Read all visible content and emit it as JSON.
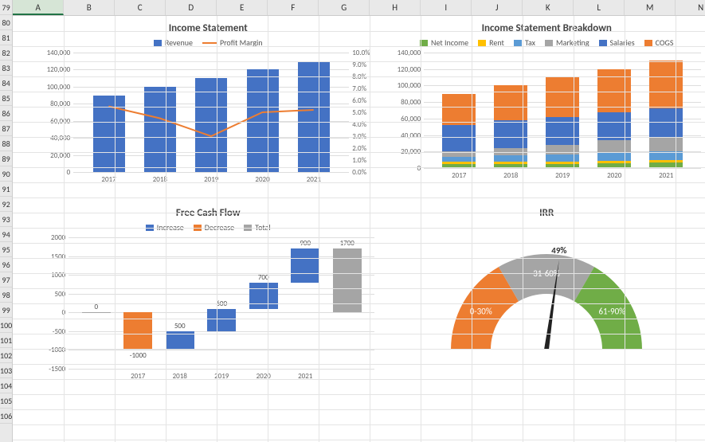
{
  "rows_start": 79,
  "rows_end": 106,
  "columns": [
    "A",
    "B",
    "C",
    "D",
    "E",
    "F",
    "G",
    "H",
    "I",
    "J",
    "K",
    "L",
    "M",
    "N"
  ],
  "selected_column": "A",
  "chart_data": [
    {
      "id": "income_statement",
      "type": "bar+line",
      "title": "Income Statement",
      "categories": [
        "2017",
        "2018",
        "2019",
        "2020",
        "2021"
      ],
      "series": [
        {
          "name": "Revenue",
          "type": "bar",
          "color": "#4472C4",
          "values": [
            90000,
            100000,
            110000,
            120000,
            130000
          ],
          "axis": "left"
        },
        {
          "name": "Profit Margin",
          "type": "line",
          "color": "#ED7D31",
          "values": [
            0.055,
            0.045,
            0.03,
            0.05,
            0.052
          ],
          "axis": "right"
        }
      ],
      "y_left": {
        "min": 0,
        "max": 140000,
        "step": 20000,
        "labels": [
          "0",
          "20,000",
          "40,000",
          "60,000",
          "80,000",
          "100,000",
          "120,000",
          "140,000"
        ]
      },
      "y_right": {
        "min": 0,
        "max": 0.1,
        "step": 0.01,
        "labels": [
          "0.0%",
          "1.0%",
          "2.0%",
          "3.0%",
          "4.0%",
          "5.0%",
          "6.0%",
          "7.0%",
          "8.0%",
          "9.0%",
          "10.0%"
        ]
      }
    },
    {
      "id": "income_breakdown",
      "type": "stacked-bar",
      "title": "Income Statement Breakdown",
      "categories": [
        "2017",
        "2018",
        "2019",
        "2020",
        "2021"
      ],
      "series": [
        {
          "name": "Net Income",
          "color": "#70AD47",
          "values": [
            5000,
            5000,
            5000,
            6000,
            7000
          ]
        },
        {
          "name": "Rent",
          "color": "#FFC000",
          "values": [
            3000,
            3000,
            3000,
            3000,
            3000
          ]
        },
        {
          "name": "Tax",
          "color": "#5B9BD5",
          "values": [
            6000,
            7000,
            8000,
            9000,
            10000
          ]
        },
        {
          "name": "Marketing",
          "color": "#A5A5A5",
          "values": [
            6000,
            9000,
            12000,
            16000,
            18000
          ]
        },
        {
          "name": "Salaries",
          "color": "#4472C4",
          "values": [
            32000,
            34000,
            34000,
            34000,
            34000
          ]
        },
        {
          "name": "COGS",
          "color": "#ED7D31",
          "values": [
            38000,
            42000,
            48000,
            52000,
            58000
          ]
        }
      ],
      "y": {
        "min": 0,
        "max": 140000,
        "step": 20000,
        "labels": [
          "0",
          "20,000",
          "40,000",
          "60,000",
          "80,000",
          "100,000",
          "120,000",
          "140,000"
        ]
      }
    },
    {
      "id": "free_cash_flow",
      "type": "waterfall",
      "title": "Free Cash Flow",
      "legend": [
        {
          "name": "Increase",
          "color": "#4472C4"
        },
        {
          "name": "Decrease",
          "color": "#ED7D31"
        },
        {
          "name": "Total",
          "color": "#A5A5A5"
        }
      ],
      "categories": [
        "",
        "2017",
        "2018",
        "2019",
        "2020",
        "2021",
        ""
      ],
      "points": [
        {
          "label": "0",
          "value": 0,
          "type": "start"
        },
        {
          "label": "-1000",
          "value": -1000,
          "type": "decrease"
        },
        {
          "label": "500",
          "value": 500,
          "type": "increase"
        },
        {
          "label": "600",
          "value": 600,
          "type": "increase"
        },
        {
          "label": "700",
          "value": 700,
          "type": "increase"
        },
        {
          "label": "900",
          "value": 900,
          "type": "increase"
        },
        {
          "label": "1700",
          "value": 1700,
          "type": "total"
        }
      ],
      "y": {
        "min": -1500,
        "max": 2000,
        "step": 500,
        "labels": [
          "-1500",
          "-1000",
          "-500",
          "0",
          "500",
          "1000",
          "1500",
          "2000"
        ]
      }
    },
    {
      "id": "irr",
      "type": "gauge",
      "title": "IRR",
      "value_label": "49%",
      "value": 0.49,
      "segments": [
        {
          "name": "0-30%",
          "color": "#ED7D31",
          "from": 0,
          "to": 0.3
        },
        {
          "name": "31-60%",
          "color": "#A5A5A5",
          "from": 0.3,
          "to": 0.6
        },
        {
          "name": "61-90%",
          "color": "#70AD47",
          "from": 0.6,
          "to": 0.9
        }
      ]
    }
  ]
}
